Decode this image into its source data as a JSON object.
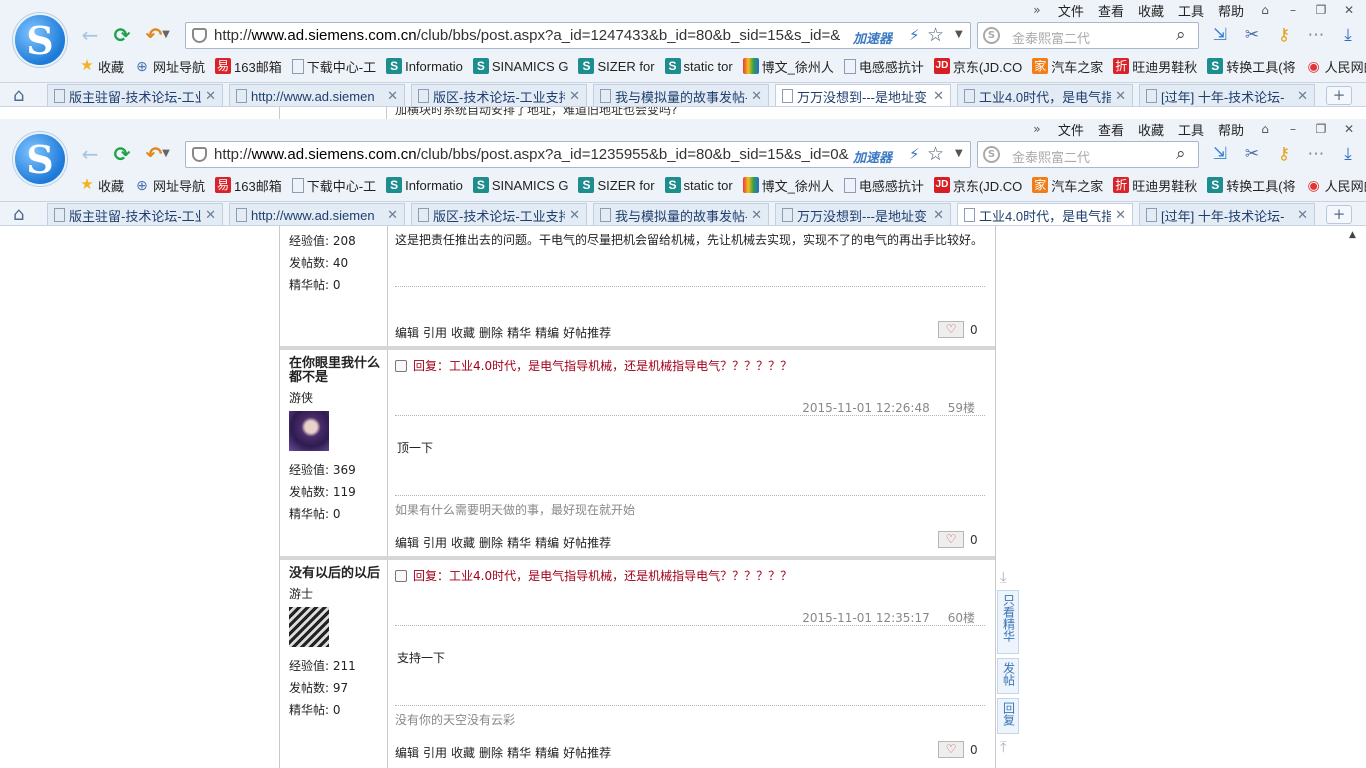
{
  "browser": {
    "menus": [
      "文件",
      "查看",
      "收藏",
      "工具",
      "帮助"
    ],
    "window_controls": [
      "»",
      "⌂",
      "–",
      "❐",
      "✕"
    ],
    "accelerator_label": "加速器",
    "search_placeholder": "金泰熙富二代",
    "bookmarks": [
      {
        "label": "收藏",
        "icon": "star-icon"
      },
      {
        "label": "网址导航",
        "icon": "globe-icon"
      },
      {
        "label": "163邮箱",
        "icon": "netease-icon"
      },
      {
        "label": "下载中心-工",
        "icon": "page-icon"
      },
      {
        "label": "Informatio",
        "icon": "siemens-s-icon"
      },
      {
        "label": "SINAMICS G",
        "icon": "siemens-s-icon"
      },
      {
        "label": "SIZER for",
        "icon": "siemens-s-icon"
      },
      {
        "label": "static tor",
        "icon": "siemens-s-icon"
      },
      {
        "label": "博文_徐州人",
        "icon": "colorful-icon"
      },
      {
        "label": "电感感抗计",
        "icon": "page-icon"
      },
      {
        "label": "京东(JD.CO",
        "icon": "jd-icon"
      },
      {
        "label": "汽车之家",
        "icon": "autohome-icon"
      },
      {
        "label": "旺迪男鞋秋",
        "icon": "zhe-icon"
      },
      {
        "label": "转换工具(将",
        "icon": "siemens-s-icon"
      },
      {
        "label": "人民网的",
        "icon": "weibo-icon"
      }
    ],
    "tabs": [
      "版主驻留-技术论坛-工业",
      "http://www.ad.siemen",
      "版区-技术论坛-工业支持",
      "我与模拟量的故事发帖-",
      "万万没想到---是地址变",
      "工业4.0时代，是电气指",
      "[过年] 十年-技术论坛-"
    ]
  },
  "window1": {
    "url_pre": "http://",
    "url_domain": "www.ad.siemens.com.cn",
    "url_path": "/club/bbs/post.aspx?a_id=1247433&b_id=80&b_sid=15&s_id=&",
    "active_tab": 4,
    "peek_text": "加横块时系统自动安排了地址，难道旧地址也会变吗?"
  },
  "window2": {
    "url_pre": "http://",
    "url_domain": "www.ad.siemens.com.cn",
    "url_path": "/club/bbs/post.aspx?a_id=1235955&b_id=80&b_sid=15&s_id=0&",
    "active_tab": 5
  },
  "posts": [
    {
      "partial": true,
      "user": {
        "stats": [
          "经验值: 208",
          "发帖数: 40",
          "精华帖: 0"
        ]
      },
      "body": "这是把责任推出去的问题。干电气的尽量把机会留给机械，先让机械去实现，实现不了的电气的再出手比较好。",
      "likes": "0"
    },
    {
      "user": {
        "name": "在你眼里我什么都不是",
        "rank": "游侠",
        "stats": [
          "经验值: 369",
          "发帖数: 119",
          "精华帖: 0"
        ]
      },
      "title_prefix": "回复：",
      "title": "工业4.0时代，是电气指导机械，还是机械指导电气？？？？？？",
      "time": "2015-11-01 12:26:48",
      "floor": "59楼",
      "body": "顶一下",
      "signature": "如果有什么需要明天做的事，最好现在就开始",
      "likes": "0"
    },
    {
      "user": {
        "name": "没有以后的以后",
        "rank": "游士",
        "stats": [
          "经验值: 211",
          "发帖数: 97",
          "精华帖: 0"
        ]
      },
      "title_prefix": "回复：",
      "title": "工业4.0时代，是电气指导机械，还是机械指导电气？？？？？？",
      "time": "2015-11-01 12:35:17",
      "floor": "60楼",
      "body": "支持一下",
      "signature": "没有你的天空没有云彩",
      "likes": "0"
    }
  ],
  "actions": [
    "编辑",
    "引用",
    "收藏",
    "删除",
    "精华",
    "精编",
    "好帖推荐"
  ],
  "side_toolbar": {
    "only_essence": "只看精华",
    "post": "发帖",
    "reply": "回复"
  }
}
